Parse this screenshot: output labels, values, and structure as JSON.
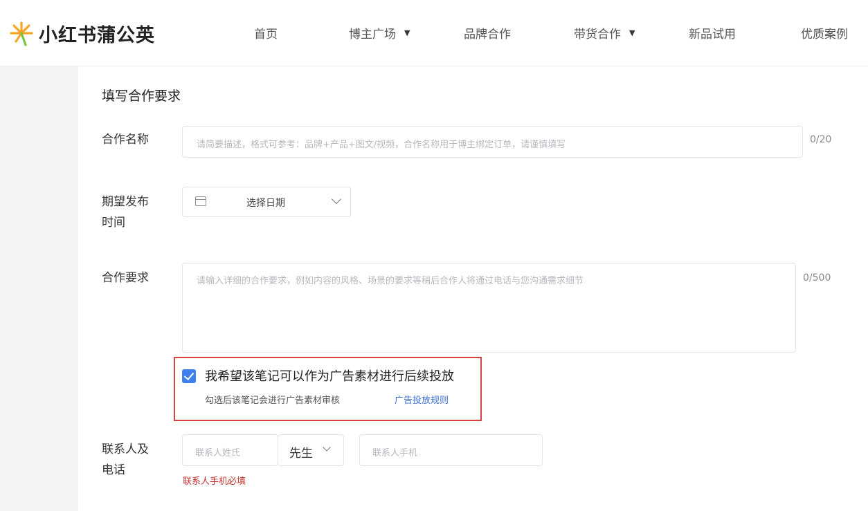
{
  "header": {
    "logo_text": "小红书蒲公英",
    "nav": [
      {
        "label": "首页",
        "has_caret": false
      },
      {
        "label": "博主广场",
        "has_caret": true
      },
      {
        "label": "品牌合作",
        "has_caret": false
      },
      {
        "label": "带货合作",
        "has_caret": true
      },
      {
        "label": "新品试用",
        "has_caret": false
      },
      {
        "label": "优质案例",
        "has_caret": false
      }
    ],
    "caret": "▼"
  },
  "form": {
    "section_title": "填写合作要求",
    "name": {
      "label": "合作名称",
      "placeholder": "请简要描述，格式可参考：品牌+产品+图文/视频，合作名称用于博主绑定订单，请谨慎填写",
      "counter": "0/20"
    },
    "publish_time": {
      "label_line1": "期望发布",
      "label_line2": "时间",
      "value": "选择日期"
    },
    "requirements": {
      "label": "合作要求",
      "placeholder": "请输入详细的合作要求，例如内容的风格、场景的要求等稍后合作人将通过电话与您沟通需求细节",
      "counter": "0/500"
    },
    "ad_material": {
      "checked": true,
      "label": "我希望该笔记可以作为广告素材进行后续投放",
      "hint": "勾选后该笔记会进行广告素材审核",
      "link": "广告投放规则"
    },
    "contact": {
      "label_line1": "联系人及",
      "label_line2": "电话",
      "surname_placeholder": "联系人姓氏",
      "title_value": "先生",
      "phone_placeholder": "联系人手机",
      "error": "联系人手机必填"
    }
  },
  "colors": {
    "accent_blue": "#3f7ff0",
    "link_blue": "#3a6fd8",
    "highlight_red": "#d9433f",
    "error_red": "#c7362f",
    "logo_orange": "#f5a623"
  }
}
